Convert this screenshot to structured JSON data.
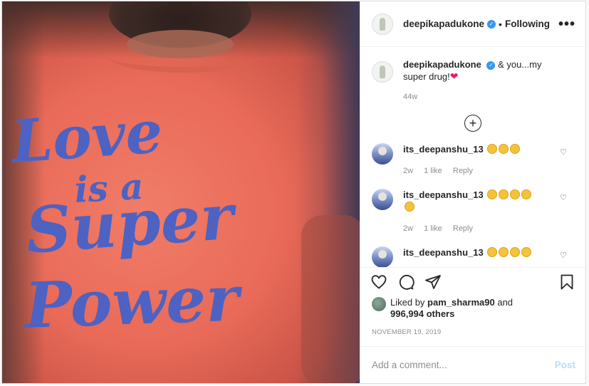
{
  "header": {
    "username": "deepikapadukone",
    "separator": "•",
    "follow_status": "Following",
    "more": "•••"
  },
  "photo": {
    "shirt_lines": [
      "Love",
      "is a",
      "Super",
      "Power"
    ]
  },
  "caption": {
    "username": "deepikapadukone",
    "text": "& you...my super drug!",
    "emoji": "❤",
    "time": "44w"
  },
  "load_more": "+",
  "comments": [
    {
      "username": "its_deepanshu_13",
      "emoji_count": 3,
      "time": "2w",
      "likes": "1 like",
      "reply": "Reply"
    },
    {
      "username": "its_deepanshu_13",
      "emoji_count": 5,
      "time": "2w",
      "likes": "1 like",
      "reply": "Reply"
    },
    {
      "username": "its_deepanshu_13",
      "emoji_count": 4,
      "time": "",
      "likes": "",
      "reply": ""
    }
  ],
  "actions": {
    "like": "heart-icon",
    "comment": "comment-icon",
    "share": "paper-plane-icon",
    "save": "bookmark-icon"
  },
  "likes": {
    "prefix": "Liked by",
    "user": "pam_sharma90",
    "and": "and",
    "count": "996,994 others"
  },
  "date": "NOVEMBER 19, 2019",
  "add_comment": {
    "placeholder": "Add a comment...",
    "post_label": "Post"
  },
  "colors": {
    "verified": "#3897f0",
    "shirt_text": "#4d62c2",
    "shirt": "#e96a58",
    "post_disabled": "#b2dffc"
  }
}
